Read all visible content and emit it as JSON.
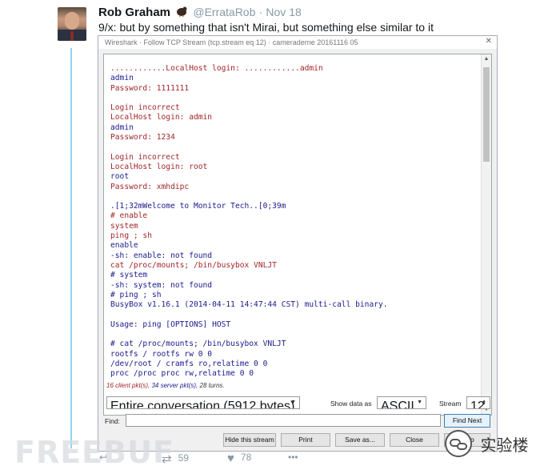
{
  "tweet": {
    "author": "Rob Graham",
    "handle": "@ErrataRob",
    "separator": "·",
    "date": "Nov 18",
    "text": "9/x: but by something that isn't Mirai, but something else similar to it",
    "actions": {
      "retweets": "59",
      "likes": "78"
    }
  },
  "wireshark": {
    "title": "Wireshark · Follow TCP Stream (tcp.stream eq 12) · cameraderne 20161116 05",
    "close_glyph": "✕",
    "stream_lines": [
      {
        "t": "............LocalHost login: ............admin",
        "k": "s"
      },
      {
        "t": "admin",
        "k": "c"
      },
      {
        "t": "Password: 1111111",
        "k": "s"
      },
      {
        "t": "",
        "k": "b"
      },
      {
        "t": "Login incorrect",
        "k": "s"
      },
      {
        "t": "LocalHost login: admin",
        "k": "s"
      },
      {
        "t": "admin",
        "k": "c"
      },
      {
        "t": "Password: 1234",
        "k": "s"
      },
      {
        "t": "",
        "k": "b"
      },
      {
        "t": "Login incorrect",
        "k": "s"
      },
      {
        "t": "LocalHost login: root",
        "k": "s"
      },
      {
        "t": "root",
        "k": "c"
      },
      {
        "t": "Password: xmhdipc",
        "k": "s"
      },
      {
        "t": "",
        "k": "b"
      },
      {
        "t": ".[1;32mWelcome to Monitor Tech..[0;39m",
        "k": "c"
      },
      {
        "t": "# enable",
        "k": "s"
      },
      {
        "t": "system",
        "k": "s"
      },
      {
        "t": "ping ; sh",
        "k": "s"
      },
      {
        "t": "enable",
        "k": "c"
      },
      {
        "t": "-sh: enable: not found",
        "k": "c"
      },
      {
        "t": "cat /proc/mounts; /bin/busybox VNLJT",
        "k": "s"
      },
      {
        "t": "# system",
        "k": "c"
      },
      {
        "t": "-sh: system: not found",
        "k": "c"
      },
      {
        "t": "# ping ; sh",
        "k": "c"
      },
      {
        "t": "BusyBox v1.16.1 (2014-04-11 14:47:44 CST) multi-call binary.",
        "k": "c"
      },
      {
        "t": "",
        "k": "b"
      },
      {
        "t": "Usage: ping [OPTIONS] HOST",
        "k": "c"
      },
      {
        "t": "",
        "k": "b"
      },
      {
        "t": "# cat /proc/mounts; /bin/busybox VNLJT",
        "k": "c"
      },
      {
        "t": "rootfs / rootfs rw 0 0",
        "k": "c"
      },
      {
        "t": "/dev/root / cramfs ro,relatime 0 0",
        "k": "c"
      },
      {
        "t": "proc /proc proc rw,relatime 0 0",
        "k": "c"
      }
    ],
    "stats": {
      "client": "16 client pkt(s),",
      "server": "34 server pkt(s),",
      "turns": "28 turns."
    },
    "conversation_select": "Entire conversation (5912 bytes)",
    "show_data_label": "Show data as",
    "show_data_value": "ASCII",
    "stream_label": "Stream",
    "stream_value": "12",
    "find_label": "Find:",
    "find_value": "",
    "find_next": "Find Next",
    "buttons": {
      "hide": "Hide this stream",
      "print": "Print",
      "save_as": "Save as...",
      "close": "Close",
      "help": "Help"
    }
  },
  "watermarks": {
    "left": "FREEBUF",
    "right": "实验楼"
  }
}
